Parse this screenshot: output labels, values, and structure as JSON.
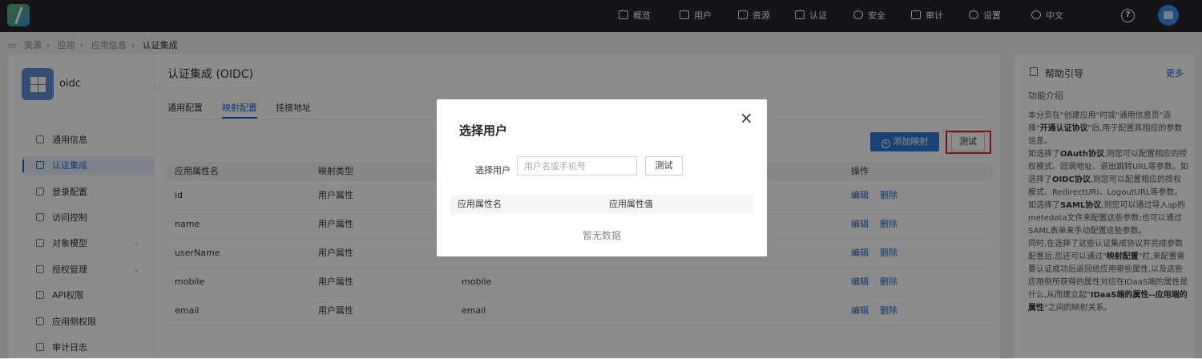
{
  "topnav": {
    "items": [
      {
        "label": "概览",
        "icon": "home-icon"
      },
      {
        "label": "用户",
        "icon": "user-icon"
      },
      {
        "label": "资源",
        "icon": "folder-icon"
      },
      {
        "label": "认证",
        "icon": "monitor-icon"
      },
      {
        "label": "安全",
        "icon": "shield-icon"
      },
      {
        "label": "审计",
        "icon": "audit-icon"
      },
      {
        "label": "设置",
        "icon": "gear-icon"
      },
      {
        "label": "中文",
        "icon": "globe-icon"
      }
    ],
    "help": "?"
  },
  "breadcrumb": [
    "资源",
    "应用",
    "应用信息",
    "认证集成"
  ],
  "app": {
    "name": "oidc",
    "menu": [
      {
        "label": "通用信息"
      },
      {
        "label": "认证集成",
        "active": true
      },
      {
        "label": "登录配置"
      },
      {
        "label": "访问控制"
      },
      {
        "label": "对象模型",
        "expand": true
      },
      {
        "label": "授权管理",
        "expand": true
      },
      {
        "label": "API权限"
      },
      {
        "label": "应用侧权限"
      },
      {
        "label": "审计日志"
      }
    ]
  },
  "main": {
    "title": "认证集成 (OIDC)",
    "tabs": [
      "通用配置",
      "映射配置",
      "挂接地址"
    ],
    "add_button": "添加映射",
    "test_button": "测试",
    "columns": [
      "应用属性名",
      "映射类型",
      "",
      "操作"
    ],
    "rows": [
      {
        "name": "id",
        "type": "用户属性",
        "value": ""
      },
      {
        "name": "name",
        "type": "用户属性",
        "value": ""
      },
      {
        "name": "userName",
        "type": "用户属性",
        "value": ""
      },
      {
        "name": "mobile",
        "type": "用户属性",
        "value": "mobile"
      },
      {
        "name": "email",
        "type": "用户属性",
        "value": "email"
      }
    ],
    "edit": "编辑",
    "delete": "删除"
  },
  "help": {
    "title": "帮助引导",
    "more": "更多",
    "subtitle": "功能介绍",
    "body_html": "本分页在\"创建应用\"时或\"通用信息页\"选择\"<b>开通认证协议</b>\"后,用于配置其相应的参数信息。<br>如选择了<b>OAuth协议</b>,则您可以配置相应的授权模式、回调地址、退出跳转URL等参数。如选择了<b>OIDC协议</b>,则您可以配置相应的授权模式、RedirectURI、LogoutURL等参数。如选择了<b>SAML协议</b>,则您可以通过导入sp的metedata文件来配置这些参数;也可以通过SAML表单来手动配置这些参数。<br>同时,在选择了这些认证集成协议并完成参数配置后,您还可以通过\"<b>映射配置</b>\"栏,来配置需要认证成功后返回给应用哪些属性,以及这些应用侧所获得的属性对应在IDaaS端的属性是什么,从而建立起\"<b>IDaaS端的属性--应用端的属性</b>\"之间的映射关系。"
  },
  "modal": {
    "title": "选择用户",
    "label": "选择用户",
    "placeholder": "用户名或手机号",
    "test": "测试",
    "col1": "应用属性名",
    "col2": "应用属性值",
    "empty": "暂无数据",
    "close": "×"
  }
}
